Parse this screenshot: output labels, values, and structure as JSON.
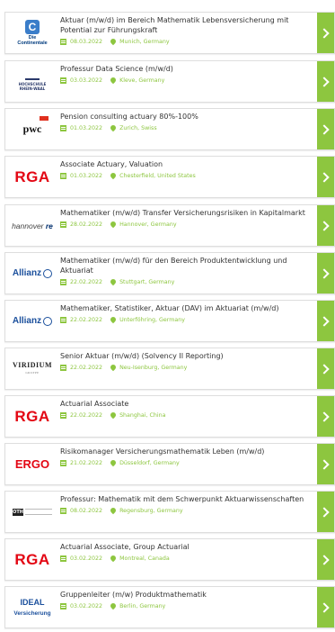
{
  "colors": {
    "accent": "#8dc63f",
    "text": "#333333"
  },
  "jobs": [
    {
      "logo": "Continentale",
      "title": "Aktuar (m/w/d) im Bereich Mathematik Lebensversicherung mit Potential zur Führungskraft",
      "date": "08.03.2022",
      "location": "Munich, Germany"
    },
    {
      "logo": "Hochschule Rhein-Waal",
      "title": "Professur Data Science (m/w/d)",
      "date": "03.03.2022",
      "location": "Kleve, Germany"
    },
    {
      "logo": "pwc",
      "title": "Pension consulting actuary 80%-100%",
      "date": "01.03.2022",
      "location": "Zurich, Swiss"
    },
    {
      "logo": "RGA",
      "title": "Associate Actuary, Valuation",
      "date": "01.03.2022",
      "location": "Chesterfield, United States"
    },
    {
      "logo": "hannover re",
      "title": "Mathematiker (m/w/d) Transfer Versicherungsrisiken in Kapitalmarkt",
      "date": "28.02.2022",
      "location": "Hannover, Germany"
    },
    {
      "logo": "Allianz",
      "title": "Mathematiker (m/w/d) für den Bereich Produktentwicklung und Aktuariat",
      "date": "22.02.2022",
      "location": "Stuttgart, Germany"
    },
    {
      "logo": "Allianz",
      "title": "Mathematiker, Statistiker, Aktuar (DAV) im Aktuariat (m/w/d)",
      "date": "22.02.2022",
      "location": "Unterföhring, Germany"
    },
    {
      "logo": "VIRIDIUM",
      "title": "Senior Aktuar (m/w/d) (Solvency II Reporting)",
      "date": "22.02.2022",
      "location": "Neu-Isenburg, Germany"
    },
    {
      "logo": "RGA",
      "title": "Actuarial Associate",
      "date": "22.02.2022",
      "location": "Shanghai, China"
    },
    {
      "logo": "ERGO",
      "title": "Risikomanager Versicherungsmathematik Leben (m/w/d)",
      "date": "21.02.2022",
      "location": "Düsseldorf, Germany"
    },
    {
      "logo": "OTH",
      "title": "Professur: Mathematik mit dem Schwerpunkt Aktuarwissenschaften",
      "date": "08.02.2022",
      "location": "Regensburg, Germany"
    },
    {
      "logo": "RGA",
      "title": "Actuarial Associate, Group Actuarial",
      "date": "03.02.2022",
      "location": "Montreal, Canada"
    },
    {
      "logo": "IDEAL Versicherung",
      "title": "Gruppenleiter (m/w) Produktmathematik",
      "date": "03.02.2022",
      "location": "Berlin, Germany"
    }
  ]
}
